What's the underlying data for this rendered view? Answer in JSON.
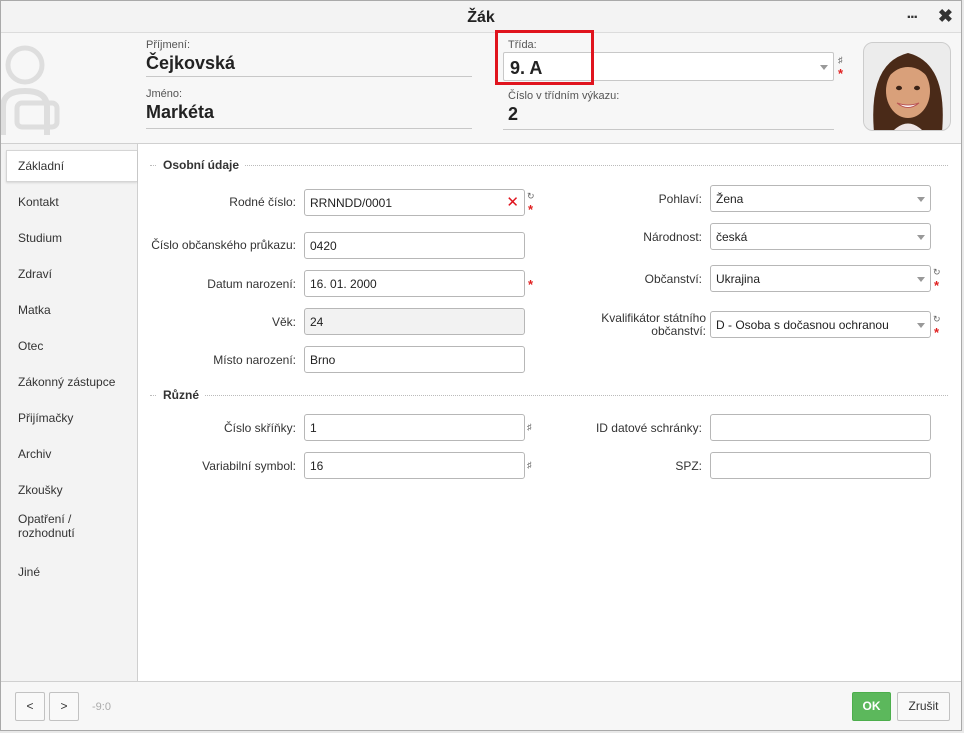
{
  "window": {
    "title": "Žák",
    "more_label": "...",
    "close_label": "✖"
  },
  "header": {
    "surname_label": "Příjmení:",
    "surname": "Čejkovská",
    "firstname_label": "Jméno:",
    "firstname": "Markéta",
    "class_label": "Třída:",
    "class_value": "9. A",
    "class_number_label": "Číslo v třídním výkazu:",
    "class_number": "2"
  },
  "sidebar": {
    "items": [
      {
        "label": "Základní"
      },
      {
        "label": "Kontakt"
      },
      {
        "label": "Studium"
      },
      {
        "label": "Zdraví"
      },
      {
        "label": "Matka"
      },
      {
        "label": "Otec"
      },
      {
        "label": "Zákonný zástupce"
      },
      {
        "label": "Přijímačky"
      },
      {
        "label": "Archiv"
      },
      {
        "label": "Zkoušky"
      },
      {
        "label": "Opatření / rozhodnutí"
      },
      {
        "label": "Jiné"
      }
    ]
  },
  "personal": {
    "section_title": "Osobní údaje",
    "birth_number_label": "Rodné číslo:",
    "birth_number": "RRNNDD/0001",
    "id_card_label": "Číslo občanského průkazu:",
    "id_card": "0420",
    "birth_date_label": "Datum narození:",
    "birth_date": "16. 01. 2000",
    "age_label": "Věk:",
    "age": "24",
    "birth_place_label": "Místo narození:",
    "birth_place": "Brno",
    "gender_label": "Pohlaví:",
    "gender": "Žena",
    "nationality_label": "Národnost:",
    "nationality": "česká",
    "citizenship_label": "Občanství:",
    "citizenship": "Ukrajina",
    "citizenship_qualifier_label_1": "Kvalifikátor státního",
    "citizenship_qualifier_label_2": "občanství:",
    "citizenship_qualifier": "D - Osoba s dočasnou ochranou"
  },
  "misc": {
    "section_title": "Různé",
    "locker_label": "Číslo skříňky:",
    "locker": "1",
    "variable_symbol_label": "Variabilní symbol:",
    "variable_symbol": "16",
    "databox_label": "ID datové schránky:",
    "databox": "",
    "plate_label": "SPZ:",
    "plate": ""
  },
  "footer": {
    "prev_label": "<",
    "next_label": ">",
    "counter": "-9:0",
    "ok_label": "OK",
    "cancel_label": "Zrušit"
  },
  "colors": {
    "accent_ok": "#5cb85c",
    "highlight_box": "#e0141e",
    "required": "#e02020"
  }
}
